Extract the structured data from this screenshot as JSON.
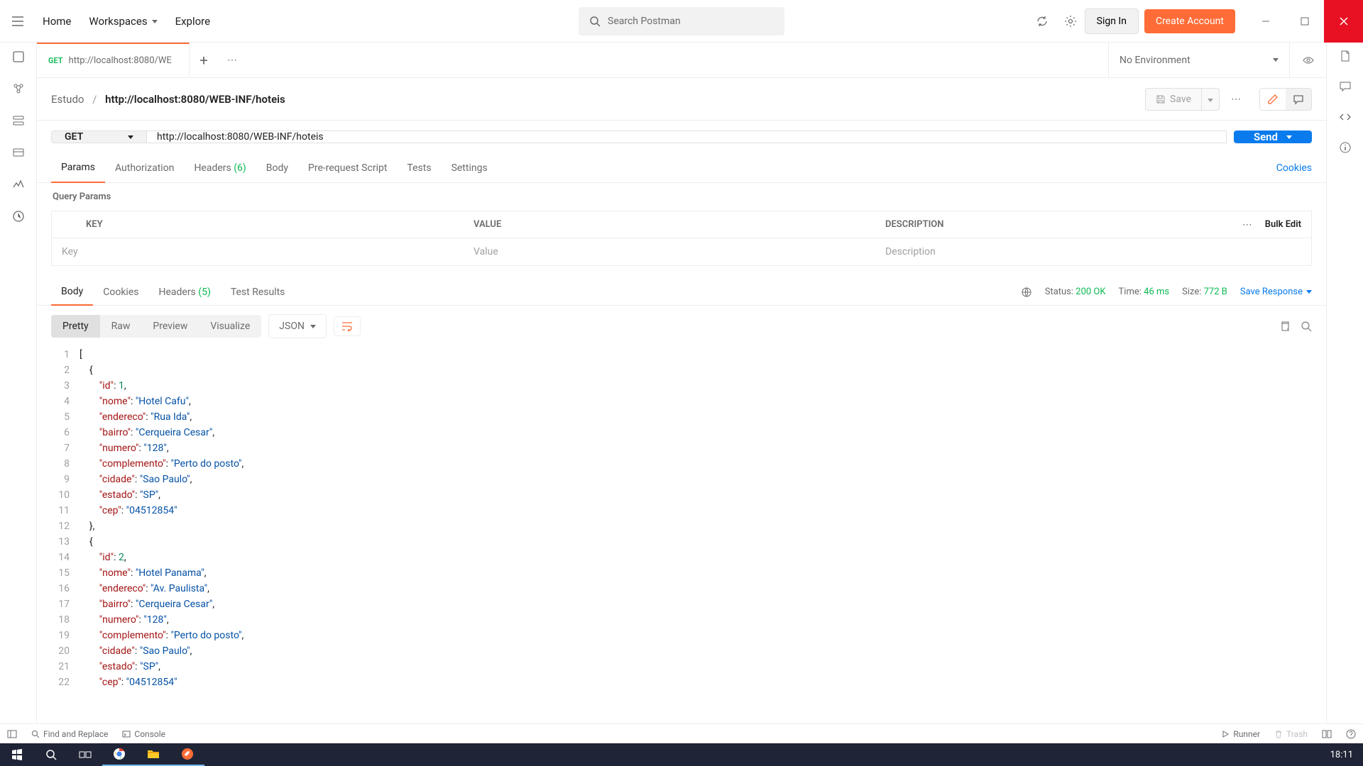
{
  "nav": {
    "home": "Home",
    "workspaces": "Workspaces",
    "explore": "Explore"
  },
  "search": {
    "placeholder": "Search Postman"
  },
  "auth": {
    "signin": "Sign In",
    "create": "Create Account"
  },
  "tab": {
    "method": "GET",
    "title": "http://localhost:8080/WE"
  },
  "env": {
    "label": "No Environment"
  },
  "breadcrumb": {
    "collection": "Estudo",
    "request": "http://localhost:8080/WEB-INF/hoteis"
  },
  "save": {
    "label": "Save"
  },
  "request": {
    "method": "GET",
    "url": "http://localhost:8080/WEB-INF/hoteis",
    "send": "Send"
  },
  "reqTabs": {
    "params": "Params",
    "auth": "Authorization",
    "headers": "Headers",
    "headersCount": "(6)",
    "body": "Body",
    "prereq": "Pre-request Script",
    "tests": "Tests",
    "settings": "Settings",
    "cookies": "Cookies"
  },
  "queryParams": {
    "title": "Query Params",
    "key": "KEY",
    "value": "VALUE",
    "desc": "DESCRIPTION",
    "bulkEdit": "Bulk Edit",
    "keyPh": "Key",
    "valuePh": "Value",
    "descPh": "Description"
  },
  "respTabs": {
    "body": "Body",
    "cookies": "Cookies",
    "headers": "Headers",
    "headersCount": "(5)",
    "testResults": "Test Results"
  },
  "respMeta": {
    "statusLabel": "Status:",
    "statusValue": "200 OK",
    "timeLabel": "Time:",
    "timeValue": "46 ms",
    "sizeLabel": "Size:",
    "sizeValue": "772 B",
    "saveResponse": "Save Response"
  },
  "viewTabs": {
    "pretty": "Pretty",
    "raw": "Raw",
    "preview": "Preview",
    "visualize": "Visualize",
    "format": "JSON"
  },
  "statusBar": {
    "findReplace": "Find and Replace",
    "console": "Console",
    "runner": "Runner",
    "trash": "Trash"
  },
  "clock": "18:11",
  "responseBody": [
    {
      "n": 1,
      "indent": 0,
      "tokens": [
        [
          "punc",
          "["
        ]
      ]
    },
    {
      "n": 2,
      "indent": 1,
      "tokens": [
        [
          "punc",
          "{"
        ]
      ]
    },
    {
      "n": 3,
      "indent": 2,
      "tokens": [
        [
          "key",
          "\"id\""
        ],
        [
          "punc",
          ": "
        ],
        [
          "num",
          "1"
        ],
        [
          "punc",
          ","
        ]
      ]
    },
    {
      "n": 4,
      "indent": 2,
      "tokens": [
        [
          "key",
          "\"nome\""
        ],
        [
          "punc",
          ": "
        ],
        [
          "str",
          "\"Hotel Cafu\""
        ],
        [
          "punc",
          ","
        ]
      ]
    },
    {
      "n": 5,
      "indent": 2,
      "tokens": [
        [
          "key",
          "\"endereco\""
        ],
        [
          "punc",
          ": "
        ],
        [
          "str",
          "\"Rua Ida\""
        ],
        [
          "punc",
          ","
        ]
      ]
    },
    {
      "n": 6,
      "indent": 2,
      "tokens": [
        [
          "key",
          "\"bairro\""
        ],
        [
          "punc",
          ": "
        ],
        [
          "str",
          "\"Cerqueira Cesar\""
        ],
        [
          "punc",
          ","
        ]
      ]
    },
    {
      "n": 7,
      "indent": 2,
      "tokens": [
        [
          "key",
          "\"numero\""
        ],
        [
          "punc",
          ": "
        ],
        [
          "str",
          "\"128\""
        ],
        [
          "punc",
          ","
        ]
      ]
    },
    {
      "n": 8,
      "indent": 2,
      "tokens": [
        [
          "key",
          "\"complemento\""
        ],
        [
          "punc",
          ": "
        ],
        [
          "str",
          "\"Perto do posto\""
        ],
        [
          "punc",
          ","
        ]
      ]
    },
    {
      "n": 9,
      "indent": 2,
      "tokens": [
        [
          "key",
          "\"cidade\""
        ],
        [
          "punc",
          ": "
        ],
        [
          "str",
          "\"Sao Paulo\""
        ],
        [
          "punc",
          ","
        ]
      ]
    },
    {
      "n": 10,
      "indent": 2,
      "tokens": [
        [
          "key",
          "\"estado\""
        ],
        [
          "punc",
          ": "
        ],
        [
          "str",
          "\"SP\""
        ],
        [
          "punc",
          ","
        ]
      ]
    },
    {
      "n": 11,
      "indent": 2,
      "tokens": [
        [
          "key",
          "\"cep\""
        ],
        [
          "punc",
          ": "
        ],
        [
          "str",
          "\"04512854\""
        ]
      ]
    },
    {
      "n": 12,
      "indent": 1,
      "tokens": [
        [
          "punc",
          "},"
        ]
      ]
    },
    {
      "n": 13,
      "indent": 1,
      "tokens": [
        [
          "punc",
          "{"
        ]
      ]
    },
    {
      "n": 14,
      "indent": 2,
      "tokens": [
        [
          "key",
          "\"id\""
        ],
        [
          "punc",
          ": "
        ],
        [
          "num",
          "2"
        ],
        [
          "punc",
          ","
        ]
      ]
    },
    {
      "n": 15,
      "indent": 2,
      "tokens": [
        [
          "key",
          "\"nome\""
        ],
        [
          "punc",
          ": "
        ],
        [
          "str",
          "\"Hotel Panama\""
        ],
        [
          "punc",
          ","
        ]
      ]
    },
    {
      "n": 16,
      "indent": 2,
      "tokens": [
        [
          "key",
          "\"endereco\""
        ],
        [
          "punc",
          ": "
        ],
        [
          "str",
          "\"Av. Paulista\""
        ],
        [
          "punc",
          ","
        ]
      ]
    },
    {
      "n": 17,
      "indent": 2,
      "tokens": [
        [
          "key",
          "\"bairro\""
        ],
        [
          "punc",
          ": "
        ],
        [
          "str",
          "\"Cerqueira Cesar\""
        ],
        [
          "punc",
          ","
        ]
      ]
    },
    {
      "n": 18,
      "indent": 2,
      "tokens": [
        [
          "key",
          "\"numero\""
        ],
        [
          "punc",
          ": "
        ],
        [
          "str",
          "\"128\""
        ],
        [
          "punc",
          ","
        ]
      ]
    },
    {
      "n": 19,
      "indent": 2,
      "tokens": [
        [
          "key",
          "\"complemento\""
        ],
        [
          "punc",
          ": "
        ],
        [
          "str",
          "\"Perto do posto\""
        ],
        [
          "punc",
          ","
        ]
      ]
    },
    {
      "n": 20,
      "indent": 2,
      "tokens": [
        [
          "key",
          "\"cidade\""
        ],
        [
          "punc",
          ": "
        ],
        [
          "str",
          "\"Sao Paulo\""
        ],
        [
          "punc",
          ","
        ]
      ]
    },
    {
      "n": 21,
      "indent": 2,
      "tokens": [
        [
          "key",
          "\"estado\""
        ],
        [
          "punc",
          ": "
        ],
        [
          "str",
          "\"SP\""
        ],
        [
          "punc",
          ","
        ]
      ]
    },
    {
      "n": 22,
      "indent": 2,
      "tokens": [
        [
          "key",
          "\"cep\""
        ],
        [
          "punc",
          ": "
        ],
        [
          "str",
          "\"04512854\""
        ]
      ]
    }
  ]
}
